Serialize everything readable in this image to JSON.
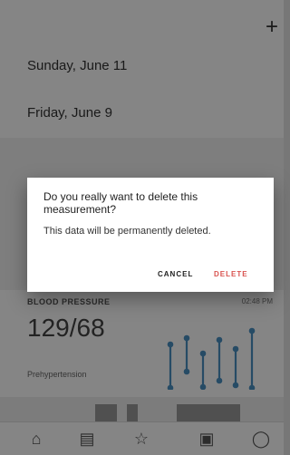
{
  "topbar": {
    "add_label": "+"
  },
  "dates": [
    {
      "label": "Sunday, June 11"
    },
    {
      "label": "Friday, June 9"
    }
  ],
  "card": {
    "title": "BLOOD PRESSURE",
    "time": "02:48 PM",
    "value": "129/68",
    "status": "Prehypertension",
    "accent": "#4a90c2"
  },
  "dialog": {
    "title": "Do you really want to delete this measurement?",
    "body": "This data will be permanently deleted.",
    "cancel_label": "CANCEL",
    "delete_label": "DELETE",
    "delete_color": "#d9534f"
  },
  "nav": [
    {
      "icon": "home-icon"
    },
    {
      "icon": "document-icon"
    },
    {
      "icon": "star-icon"
    },
    {
      "icon": "device-icon"
    },
    {
      "icon": "user-icon"
    }
  ]
}
